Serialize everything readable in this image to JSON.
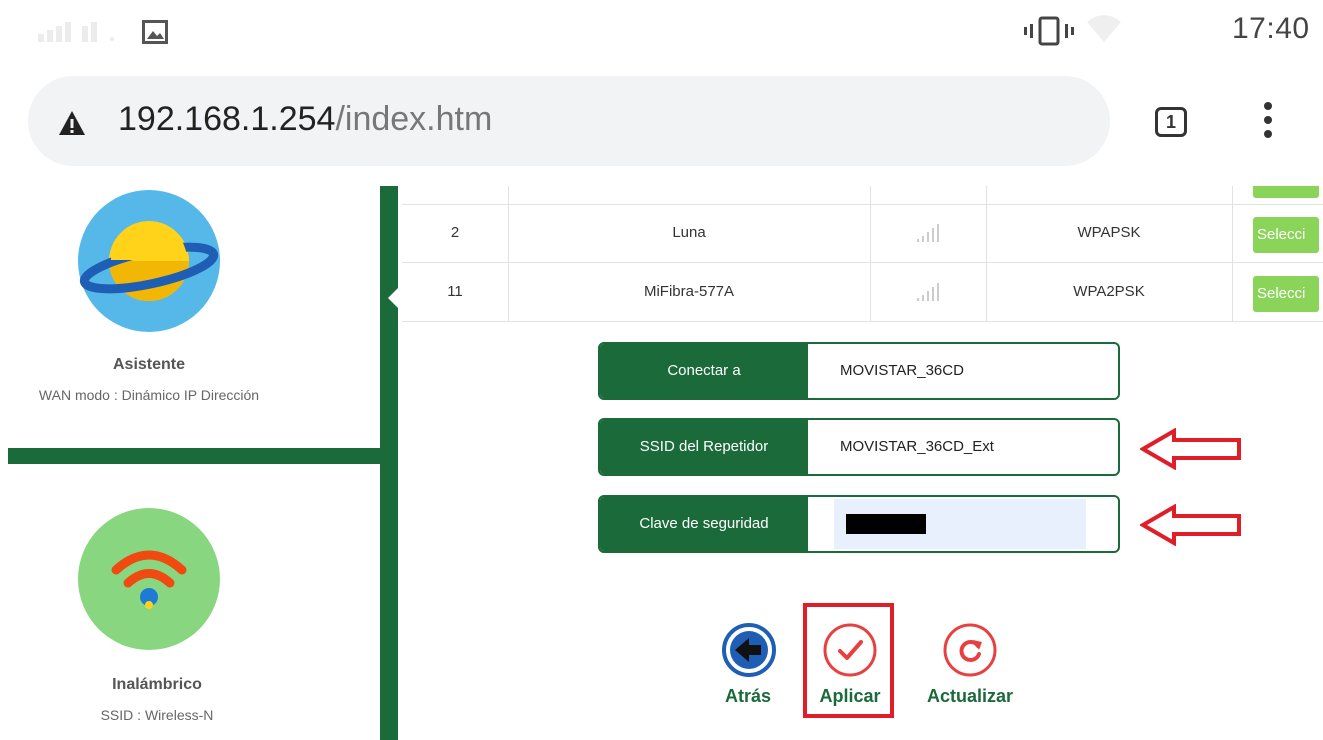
{
  "status_bar": {
    "time": "17:40"
  },
  "browser": {
    "url_host": "192.168.1.254",
    "url_path": "/index.htm",
    "tab_count": "1"
  },
  "sidebar": {
    "cards": [
      {
        "title": "Asistente",
        "subtitle": "WAN modo : Dinámico IP Dirección",
        "icon": "planet-icon"
      },
      {
        "title": "Inalámbrico",
        "subtitle": "SSID : Wireless-N",
        "icon": "wifi-icon"
      }
    ]
  },
  "networks": {
    "rows": [
      {
        "channel": "2",
        "ssid": "Luna",
        "security": "WPAPSK",
        "select_label": "Selecci"
      },
      {
        "channel": "11",
        "ssid": "MiFibra-577A",
        "security": "WPA2PSK",
        "select_label": "Selecci"
      }
    ]
  },
  "form": {
    "connect_to": {
      "label": "Conectar a",
      "value": "MOVISTAR_36CD"
    },
    "repeater_ssid": {
      "label": "SSID del Repetidor",
      "value": "MOVISTAR_36CD_Ext"
    },
    "security_key": {
      "label": "Clave de seguridad",
      "value": ""
    }
  },
  "actions": {
    "back": "Atrás",
    "apply": "Aplicar",
    "refresh": "Actualizar"
  },
  "colors": {
    "brand_green": "#1a6a3a",
    "select_green": "#8bd45a",
    "annotation_red": "#e01e2a"
  }
}
